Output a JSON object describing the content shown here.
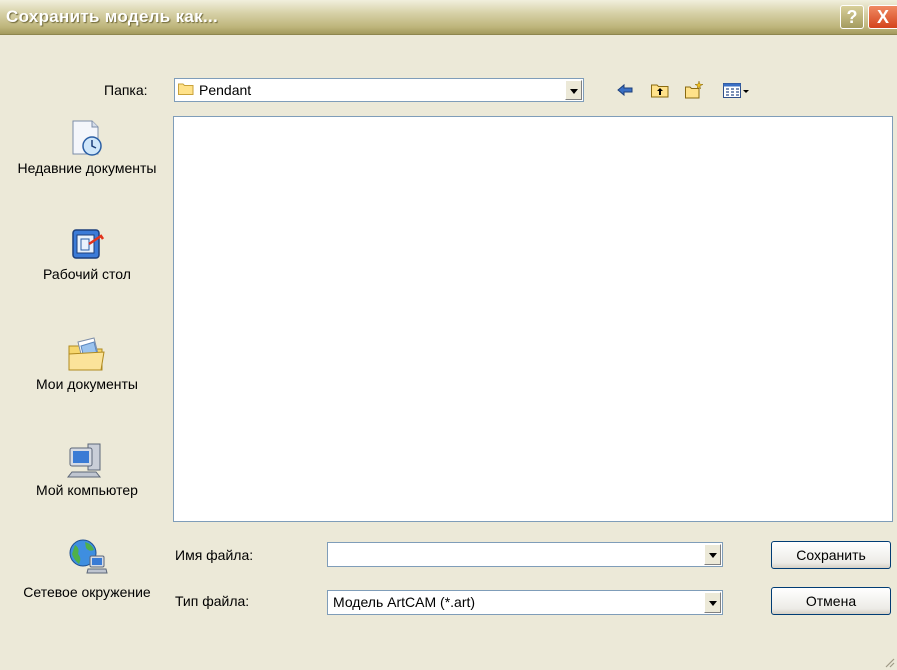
{
  "window": {
    "title": "Сохранить модель как...",
    "help_label": "?",
    "close_label": "X"
  },
  "toolbar": {
    "folder_label": "Папка:",
    "current_folder": "Pendant",
    "icons": [
      "back-icon",
      "up-folder-icon",
      "new-folder-icon",
      "view-menu-icon"
    ]
  },
  "places": [
    {
      "label": "Недавние документы",
      "icon": "recent-documents-icon"
    },
    {
      "label": "Рабочий стол",
      "icon": "desktop-icon"
    },
    {
      "label": "Мои документы",
      "icon": "my-documents-icon"
    },
    {
      "label": "Мой компьютер",
      "icon": "my-computer-icon"
    },
    {
      "label": "Сетевое окружение",
      "icon": "network-icon"
    }
  ],
  "form": {
    "filename_label": "Имя файла:",
    "filename_value": "",
    "filetype_label": "Тип файла:",
    "filetype_value": "Модель ArtCAM (*.art)"
  },
  "buttons": {
    "save_label": "Сохранить",
    "cancel_label": "Отмена"
  },
  "colors": {
    "dialog_bg": "#ECE9D8",
    "titlebar": "#BDB47A",
    "close": "#D4431C",
    "field_border": "#7F9DB9"
  }
}
